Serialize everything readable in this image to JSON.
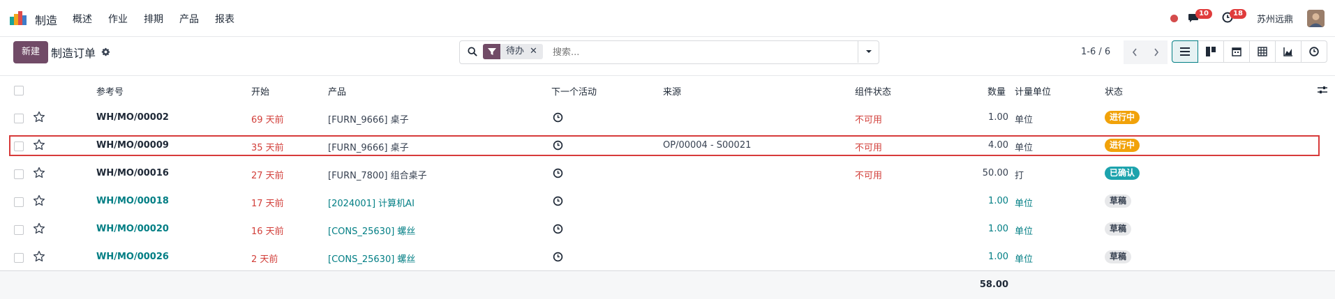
{
  "app": {
    "name": "制造",
    "menu": [
      "概述",
      "作业",
      "排期",
      "产品",
      "报表"
    ],
    "company": "苏州远鼎",
    "badges": {
      "messages": "10",
      "activities": "18"
    }
  },
  "control": {
    "new_label": "新建",
    "title": "制造订单",
    "facet_label": "待办",
    "facet_close": "✕",
    "search_placeholder": "搜索...",
    "pager": "1-6 / 6"
  },
  "columns": {
    "reference": "参考号",
    "start": "开始",
    "product": "产品",
    "next_activity": "下一个活动",
    "source": "来源",
    "component_status": "组件状态",
    "quantity": "数量",
    "uom": "计量单位",
    "state": "状态"
  },
  "rows": [
    {
      "ref": "WH/MO/00002",
      "start": "69 天前",
      "product": "[FURN_9666] 桌子",
      "source": "",
      "component": "不可用",
      "qty": "1.00",
      "uom": "单位",
      "state": "进行中",
      "state_kind": "progress",
      "draft": false
    },
    {
      "ref": "WH/MO/00009",
      "start": "35 天前",
      "product": "[FURN_9666] 桌子",
      "source": "OP/00004 - S00021",
      "component": "不可用",
      "qty": "4.00",
      "uom": "单位",
      "state": "进行中",
      "state_kind": "progress",
      "draft": false
    },
    {
      "ref": "WH/MO/00016",
      "start": "27 天前",
      "product": "[FURN_7800] 组合桌子",
      "source": "",
      "component": "不可用",
      "qty": "50.00",
      "uom": "打",
      "state": "已确认",
      "state_kind": "confirmed",
      "draft": false
    },
    {
      "ref": "WH/MO/00018",
      "start": "17 天前",
      "product": "[2024001] 计算机AI",
      "source": "",
      "component": "",
      "qty": "1.00",
      "uom": "单位",
      "state": "草稿",
      "state_kind": "draft",
      "draft": true
    },
    {
      "ref": "WH/MO/00020",
      "start": "16 天前",
      "product": "[CONS_25630] 螺丝",
      "source": "",
      "component": "",
      "qty": "1.00",
      "uom": "单位",
      "state": "草稿",
      "state_kind": "draft",
      "draft": true
    },
    {
      "ref": "WH/MO/00026",
      "start": "2 天前",
      "product": "[CONS_25630] 螺丝",
      "source": "",
      "component": "",
      "qty": "1.00",
      "uom": "单位",
      "state": "草稿",
      "state_kind": "draft",
      "draft": true
    }
  ],
  "total_qty": "58.00",
  "colors": {
    "brand": "#714b67",
    "link": "#017e84",
    "late": "#d23f3a",
    "progress": "#f1a20a",
    "confirmed": "#1ca3ad"
  },
  "icons": [
    "search-icon",
    "filter-icon",
    "chevron-left-icon",
    "chevron-right-icon",
    "list-view-icon",
    "kanban-view-icon",
    "calendar-view-icon",
    "pivot-view-icon",
    "graph-view-icon",
    "activity-view-icon",
    "star-icon",
    "clock-icon",
    "gear-icon",
    "chat-icon",
    "adjust-columns-icon"
  ]
}
